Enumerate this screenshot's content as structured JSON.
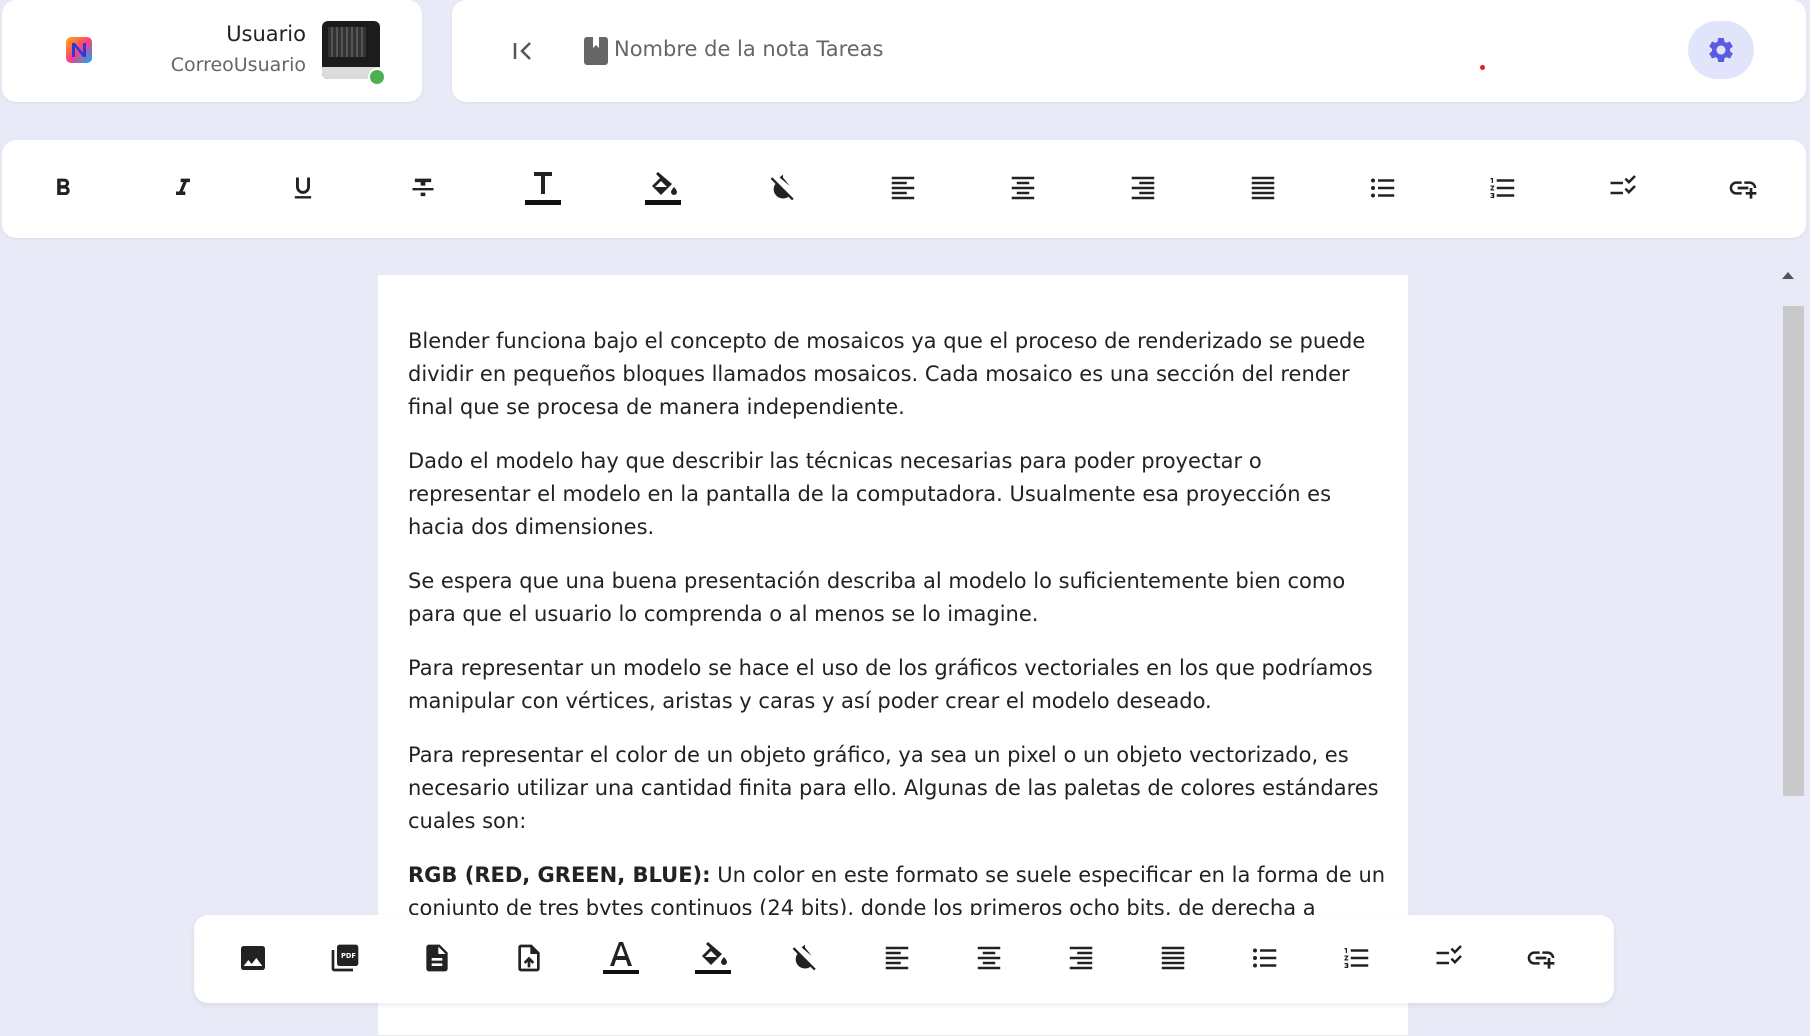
{
  "user": {
    "name": "Usuario",
    "email": "CorreoUsuario"
  },
  "header": {
    "note_title": "Nombre de la nota Tareas"
  },
  "colors": {
    "background": "#e8ebf7",
    "accent": "#5b5ce2",
    "settings_bg": "#e2e4fb",
    "online": "#4caf50"
  },
  "toolbar": {
    "items": [
      {
        "name": "bold",
        "icon": "bold-icon"
      },
      {
        "name": "italic",
        "icon": "italic-icon"
      },
      {
        "name": "underline",
        "icon": "underline-icon"
      },
      {
        "name": "strikethrough",
        "icon": "strikethrough-icon"
      },
      {
        "name": "text-color",
        "icon": "text-color-icon"
      },
      {
        "name": "highlight",
        "icon": "fill-color-icon"
      },
      {
        "name": "clear-color",
        "icon": "no-color-icon"
      },
      {
        "name": "align-left",
        "icon": "align-left-icon"
      },
      {
        "name": "align-center",
        "icon": "align-center-icon"
      },
      {
        "name": "align-right",
        "icon": "align-right-icon"
      },
      {
        "name": "align-justify",
        "icon": "align-justify-icon"
      },
      {
        "name": "bullet-list",
        "icon": "bullet-list-icon"
      },
      {
        "name": "numbered-list",
        "icon": "numbered-list-icon"
      },
      {
        "name": "checklist",
        "icon": "checklist-icon"
      },
      {
        "name": "insert-link",
        "icon": "add-link-icon"
      }
    ]
  },
  "editor": {
    "p1": "Blender funciona bajo el concepto de mosaicos ya que el proceso de renderizado se puede dividir en pequeños bloques llamados mosaicos. Cada mosaico es una sección del render final que se procesa de manera independiente.",
    "p2": "Dado el modelo hay que describir las técnicas necesarias para poder proyectar o representar el modelo en la pantalla de la computadora. Usualmente esa proyección es hacia dos dimensiones.",
    "p3": "Se espera que una buena presentación describa al modelo lo suficientemente bien como para que el usuario lo comprenda o al menos se lo imagine.",
    "p4": "Para representar un modelo se hace el uso de los gráficos vectoriales en los que podríamos manipular con vértices, aristas y caras y así poder crear el modelo deseado.",
    "p5": "Para representar el color de un objeto gráfico, ya sea un pixel o un objeto vectorizado, es necesario utilizar una cantidad finita para ello. Algunas de las paletas de colores estándares cuales son:",
    "p6_bold": "RGB (RED, GREEN, BLUE):",
    "p6_rest": " Un color en este formato se suele especificar en la forma de un conjunto de tres bytes continuos (24 bits), donde los primeros ocho bits, de derecha a izquierda, indican la intensidad de luz azul, los siguientes la de luz verde y los últimos la intensidad de luz roja."
  },
  "bottom_toolbar": {
    "items": [
      {
        "name": "insert-image",
        "icon": "image-icon"
      },
      {
        "name": "insert-pdf",
        "icon": "pdf-icon"
      },
      {
        "name": "insert-document",
        "icon": "document-icon"
      },
      {
        "name": "upload-file",
        "icon": "file-upload-icon"
      },
      {
        "name": "text-color",
        "icon": "text-color-icon"
      },
      {
        "name": "highlight",
        "icon": "fill-color-icon"
      },
      {
        "name": "clear-color",
        "icon": "no-color-icon"
      },
      {
        "name": "align-left",
        "icon": "align-left-icon"
      },
      {
        "name": "align-center",
        "icon": "align-center-icon"
      },
      {
        "name": "align-right",
        "icon": "align-right-icon"
      },
      {
        "name": "align-justify",
        "icon": "align-justify-icon"
      },
      {
        "name": "bullet-list",
        "icon": "bullet-list-icon"
      },
      {
        "name": "numbered-list",
        "icon": "numbered-list-icon"
      },
      {
        "name": "checklist",
        "icon": "checklist-icon"
      },
      {
        "name": "insert-link",
        "icon": "add-link-icon"
      }
    ]
  }
}
